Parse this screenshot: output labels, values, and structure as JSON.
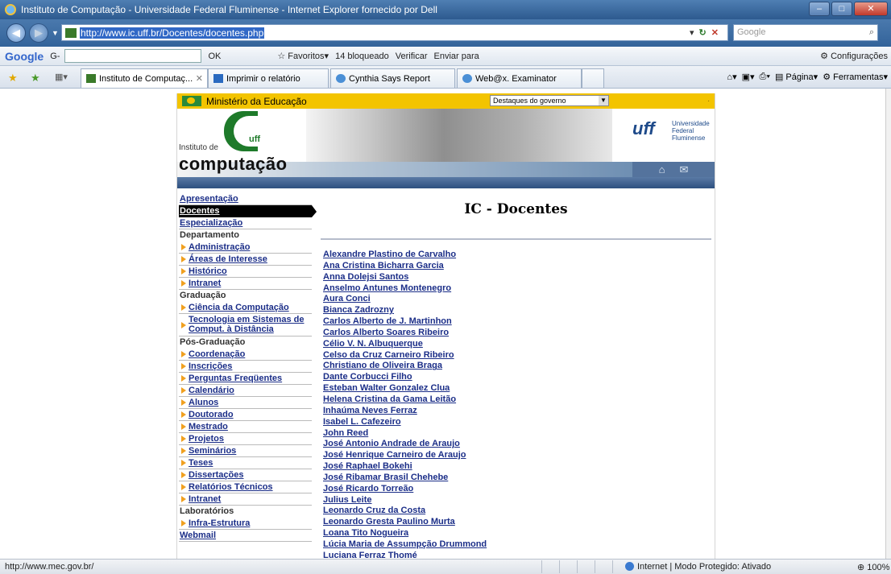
{
  "window": {
    "title": "Instituto de Computação - Universidade Federal Fluminense - Internet Explorer fornecido por Dell"
  },
  "address": {
    "url": "http://www.ic.uff.br/Docentes/docentes.php",
    "search_placeholder": "Google"
  },
  "google_toolbar": {
    "brand": "Google",
    "brand_g": "G-",
    "ok": "OK",
    "favorites": "Favoritos",
    "blocked": "14 bloqueado",
    "verify": "Verificar",
    "send": "Enviar para",
    "settings": "Configurações"
  },
  "tabs": [
    {
      "label": "Instituto de Computaç...",
      "active": true
    },
    {
      "label": "Imprimir o relatório",
      "active": false
    },
    {
      "label": "Cynthia Says Report",
      "active": false
    },
    {
      "label": "Web@x. Examinator",
      "active": false
    }
  ],
  "command_bar": {
    "page": "Página",
    "tools": "Ferramentas"
  },
  "site": {
    "gov_bar": {
      "ministry": "Ministério da Educação",
      "select": "Destaques do governo",
      "accent": "#f3c400"
    },
    "logo": {
      "line1": "Instituto de",
      "line2": "computação",
      "uff_small": "uff"
    },
    "uff": {
      "mark": "uff",
      "line1": "Universidade",
      "line2": "Federal",
      "line3": "Fluminense"
    },
    "menu": [
      {
        "label": "Apresentação",
        "type": "link"
      },
      {
        "label": "Docentes",
        "type": "current"
      },
      {
        "label": "Especialização",
        "type": "link"
      },
      {
        "label": "Departamento",
        "type": "section"
      },
      {
        "label": "Administração",
        "type": "sub"
      },
      {
        "label": "Áreas de Interesse",
        "type": "sub"
      },
      {
        "label": "Histórico",
        "type": "sub"
      },
      {
        "label": "Intranet",
        "type": "sub"
      },
      {
        "label": "Graduação",
        "type": "section"
      },
      {
        "label": "Ciência da Computação",
        "type": "sub"
      },
      {
        "label": "Tecnologia em Sistemas de Comput. à Distância",
        "type": "subtall"
      },
      {
        "label": "Pós-Graduação",
        "type": "section"
      },
      {
        "label": "Coordenação",
        "type": "sub"
      },
      {
        "label": "Inscrições",
        "type": "sub"
      },
      {
        "label": "Perguntas Freqüentes",
        "type": "sub"
      },
      {
        "label": "Calendário",
        "type": "sub"
      },
      {
        "label": "Alunos",
        "type": "sub"
      },
      {
        "label": "Doutorado",
        "type": "sub"
      },
      {
        "label": "Mestrado",
        "type": "sub"
      },
      {
        "label": "Projetos",
        "type": "sub"
      },
      {
        "label": "Seminários",
        "type": "sub"
      },
      {
        "label": "Teses",
        "type": "sub"
      },
      {
        "label": "Dissertações",
        "type": "sub"
      },
      {
        "label": "Relatórios Técnicos",
        "type": "sub"
      },
      {
        "label": "Intranet",
        "type": "sub"
      },
      {
        "label": "Laboratórios",
        "type": "section"
      },
      {
        "label": "Infra-Estrutura",
        "type": "sub"
      },
      {
        "label": "Webmail",
        "type": "link"
      }
    ],
    "page_title": "IC - Docentes",
    "docentes": [
      "Alexandre Plastino de Carvalho",
      "Ana Cristina Bicharra Garcia",
      "Anna Dolejsi Santos",
      "Anselmo Antunes Montenegro",
      "Aura Conci",
      "Bianca Zadrozny",
      "Carlos Alberto de J. Martinhon",
      "Carlos Alberto Soares Ribeiro",
      "Célio V. N. Albuquerque",
      "Celso da Cruz Carneiro Ribeiro",
      "Christiano de Oliveira Braga",
      "Dante Corbucci Filho",
      "Esteban Walter Gonzalez Clua",
      "Helena Cristina da Gama Leitão",
      "Inhaúma Neves Ferraz",
      "Isabel L. Cafezeiro",
      "John Reed",
      "José Antonio Andrade de Araujo",
      "José Henrique Carneiro de Araujo",
      "José Raphael Bokehi",
      "José Ribamar Brasil Chehebe",
      "José Ricardo Torreão",
      "Julius Leite",
      "Leonardo Cruz da Costa",
      "Leonardo Gresta Paulino Murta",
      "Loana Tito Nogueira",
      "Lúcia Maria de Assumpção Drummond",
      "Luciana Ferraz Thomé"
    ]
  },
  "status": {
    "text": "http://www.mec.gov.br/",
    "zone": "Internet | Modo Protegido: Ativado",
    "zoom": "100%"
  }
}
